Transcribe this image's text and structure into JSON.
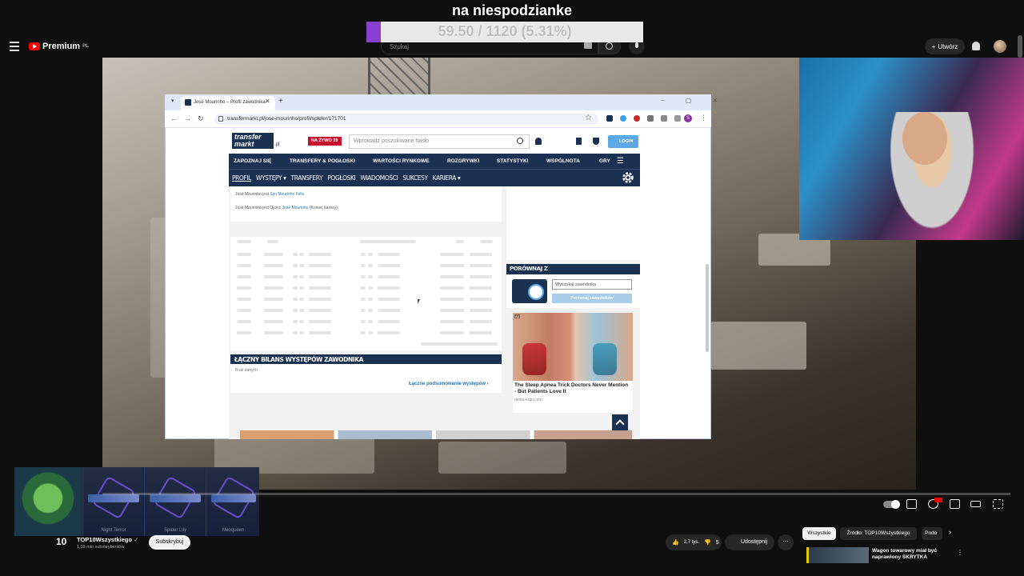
{
  "overlay": {
    "title": "na niespodzianke",
    "progress_text": "59.50 / 1120 (5.31%)",
    "progress_fraction": 0.0531,
    "progress_color": "#8a3fd0"
  },
  "youtube": {
    "brand": "Premium",
    "brand_suffix": "PL",
    "search_placeholder": "Szukaj",
    "create_label": "Utwórz",
    "channel": {
      "logo_text": "10",
      "name": "TOP10Wszystkiego",
      "verified": "✓",
      "subs": "1,38 mln subskrybentów",
      "subscribe_label": "Subskrybuj"
    },
    "actions": {
      "like_count": "2,7 tys.",
      "dislike_count": "5",
      "share_label": "Udostępnij",
      "more_label": "···"
    },
    "chips": [
      "Wszystkie",
      "Źródło: TOP10Wszystkiego",
      "Podo"
    ],
    "recommendation": {
      "title": "Wagon towarowy miał być naprawiony SKRYTKA"
    }
  },
  "browser": {
    "tab_title": "José Mourinho – Profil zawodnika",
    "url": "transfermarkt.pl/jose-mourinho/profil/spieler/171701",
    "profile_initial": "S",
    "window_controls": "–  ▢  ✕"
  },
  "transfermarkt": {
    "logo_line1": "transfer",
    "logo_line2": "markt",
    "logo_suffix": ".pl",
    "live_label": "NA ŻYWO 39",
    "search_placeholder": "Wprowadź poszukiwane hasło",
    "login_label": "LOGIN",
    "nav": [
      "ZAPOZNAJ SIĘ",
      "TRANSFERY & POGŁOSKI",
      "WARTOŚCI RYNKOWE",
      "ROZGRYWKI",
      "STATYSTYKI",
      "WSPÓLNOTA",
      "GRY"
    ],
    "subnav": [
      "PROFIL",
      "WYSTĘPY ▾",
      "TRANSFERY",
      "POGŁOSKI",
      "WIADOMOŚCI",
      "SUKCESY",
      "KARIERA ▾"
    ],
    "relations": {
      "line1_prefix": "José Mourinho jest ",
      "line1_link": "Syn Mourinho Félix",
      "line1_suffix": ".",
      "line2_prefix": "José Mourinho jest Ojciec ",
      "line2_link": "José Mourinho",
      "line2_suffix": " (Koniec kariery)."
    },
    "bilans": {
      "title": "ŁĄCZNY BILANS WYSTĘPÓW ZAWODNIKA",
      "no_data": "Brak danych",
      "link": "Łączne podsumowanie występów ›"
    },
    "compare": {
      "title": "PORÓWNAJ Z",
      "input_placeholder": "Wyszukaj zawodnika",
      "button": "Porównaj zawodników"
    },
    "ad": {
      "label": "Ad",
      "title": "The Sleep Apnea Trick Doctors Never Mention - But Patients Love It",
      "source": "derila-ergo.com"
    }
  },
  "case_items": [
    {
      "name": "Night Terror"
    },
    {
      "name": "Spider Lily"
    },
    {
      "name": "Neoqueen"
    }
  ]
}
